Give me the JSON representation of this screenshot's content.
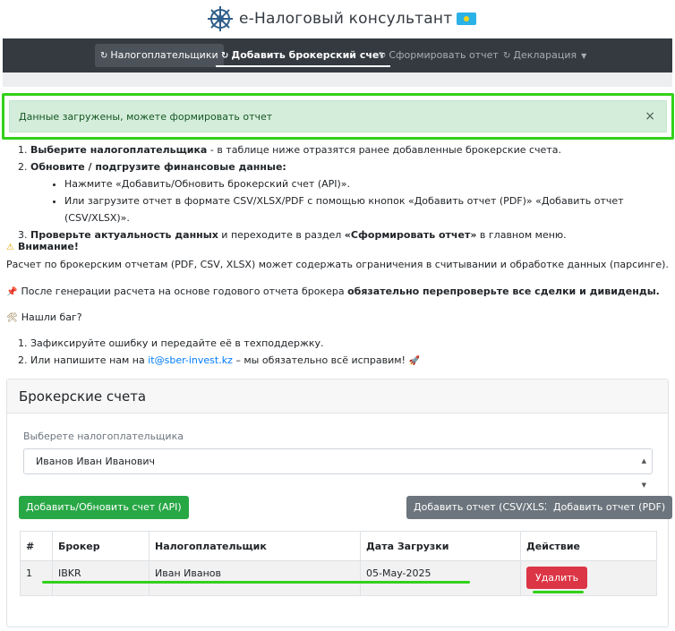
{
  "header": {
    "title": "e-Налоговый консультант"
  },
  "nav": {
    "items": [
      {
        "label": "Налогоплательщики"
      },
      {
        "label": "Добавить брокерский счет"
      },
      {
        "label": "Сформировать отчет"
      },
      {
        "label": "Декларация"
      }
    ]
  },
  "alert": {
    "text": "Данные загружены, можете формировать отчет",
    "close": "×"
  },
  "instructions": {
    "step1_bold": "Выберите налогоплательщика",
    "step1_rest": " - в таблице ниже отразятся ранее добавленные брокерские счета.",
    "step2_bold": "Обновите / подгрузите финансовые данные:",
    "step2_sub1": "Нажмите «Добавить/Обновить брокерский счет (API)».",
    "step2_sub2": "Или загрузите отчет в формате CSV/XLSX/PDF с помощью кнопок «Добавить отчет (PDF)» «Добавить отчет (CSV/XLSX)».",
    "step3_bold": "Проверьте актуальность данных",
    "step3_mid": " и переходите в раздел ",
    "step3_bold2": "«Сформировать отчет»",
    "step3_end": " в главном меню."
  },
  "warning": {
    "title": "Внимание!",
    "text": "Расчет по брокерским отчетам (PDF, CSV, XLSX) может содержать ограничения в считывании и обработке данных (парсинге)."
  },
  "pin_note": {
    "text": "После генерации расчета на основе годового отчета брокера ",
    "bold": "обязательно перепроверьте все сделки и дивиденды."
  },
  "bug": {
    "title": "Нашли баг?",
    "step1": "Зафиксируйте ошибку и передайте её в техподдержку.",
    "step2_prefix": "Или напишите нам на ",
    "email": "it@sber-invest.kz",
    "step2_suffix": " – мы обязательно всё исправим!"
  },
  "card": {
    "title": "Брокерские счета",
    "select_label": "Выберете налогоплательщика",
    "select_value": "Иванов Иван Иванович",
    "btn_api": "Добавить/Обновить счет (API)",
    "btn_csv": "Добавить отчет (CSV/XLSX)",
    "btn_pdf": "Добавить отчет (PDF)"
  },
  "table": {
    "headers": [
      "#",
      "Брокер",
      "Налогоплательщик",
      "Дата Загрузки",
      "Действие"
    ],
    "rows": [
      {
        "num": "1",
        "broker": "IBKR",
        "taxpayer": "Иван Иванов",
        "date": "05-May-2025",
        "action": "Удалить"
      }
    ]
  },
  "colors": {
    "highlight": "#33d11a",
    "navbar": "#343a40",
    "success": "#28a745",
    "danger": "#dc3545"
  }
}
